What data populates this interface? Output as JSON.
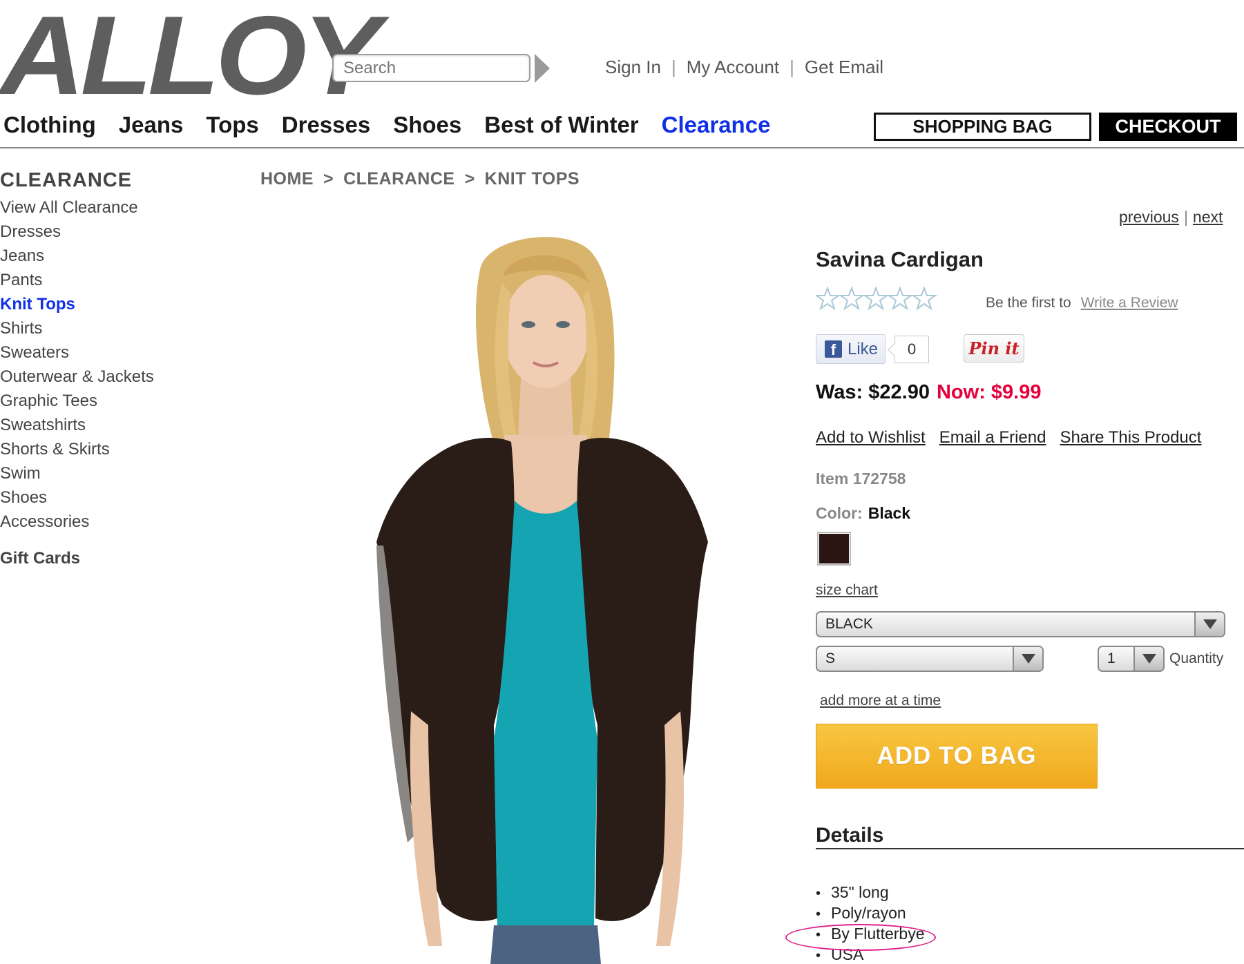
{
  "header": {
    "logo_text": "ALLOY",
    "search_placeholder": "Search",
    "account_links": [
      "Sign In",
      "My Account",
      "Get Email"
    ],
    "account_separator": "|"
  },
  "nav": {
    "items": [
      "Clothing",
      "Jeans",
      "Tops",
      "Dresses",
      "Shoes",
      "Best of Winter",
      "Clearance"
    ],
    "active_item": "Clearance",
    "active_color": "#1030e6",
    "shopping_bag_label": "SHOPPING BAG",
    "checkout_label": "CHECKOUT"
  },
  "sidebar": {
    "title": "CLEARANCE",
    "items": [
      "View All Clearance",
      "Dresses",
      "Jeans",
      "Pants",
      "Knit Tops",
      "Shirts",
      "Sweaters",
      "Outerwear & Jackets",
      "Graphic Tees",
      "Sweatshirts",
      "Shorts & Skirts",
      "Swim",
      "Shoes",
      "Accessories"
    ],
    "active_item": "Knit Tops",
    "gift_cards": "Gift Cards"
  },
  "breadcrumb": {
    "items": [
      "HOME",
      "CLEARANCE",
      "KNIT TOPS"
    ],
    "separator": ">"
  },
  "pager": {
    "previous": "previous",
    "separator": "|",
    "next": "next"
  },
  "product": {
    "title": "Savina Cardigan",
    "rating": 0,
    "rating_max": 5,
    "review_prompt": "Be the first to",
    "review_link": "Write a Review",
    "like_label": "Like",
    "like_count": "0",
    "pinit_label": "Pin it",
    "was_label": "Was:",
    "was_price": "$22.90",
    "now_label": "Now:",
    "now_price": "$9.99",
    "sale_color": "#e5003b",
    "action_links": [
      "Add to Wishlist",
      "Email a Friend",
      "Share This Product"
    ],
    "item_number": "Item 172758",
    "color_label": "Color:",
    "color_value": "Black",
    "swatch_color": "#2a1512",
    "size_chart": "size chart",
    "color_select_value": "BLACK",
    "size_select_value": "S",
    "qty_select_value": "1",
    "qty_label": "Quantity",
    "add_more": "add more at a time",
    "add_to_bag": "ADD TO BAG",
    "add_to_bag_color": "#f3b52c"
  },
  "details": {
    "title": "Details",
    "items": [
      "35\" long",
      "Poly/rayon",
      "By Flutterbye",
      "USA"
    ],
    "highlighted_item": "By Flutterbye",
    "highlight_color": "#e0208a"
  }
}
